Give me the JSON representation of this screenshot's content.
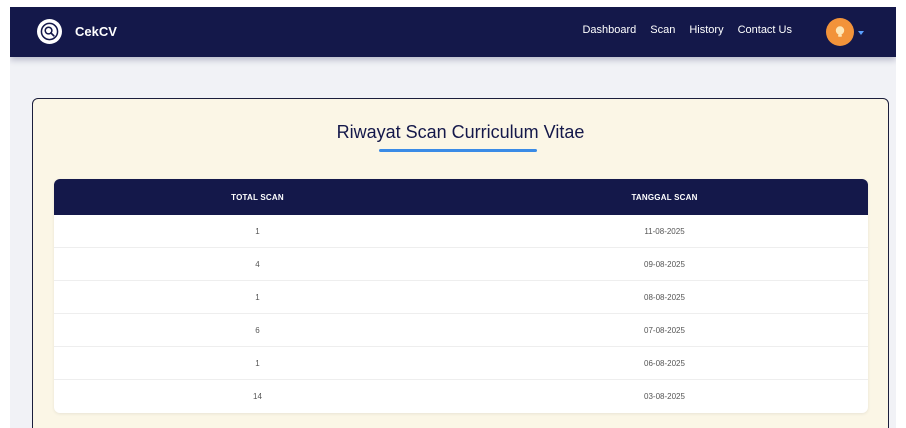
{
  "brand": {
    "name": "CekCV"
  },
  "nav": {
    "links": [
      "Dashboard",
      "Scan",
      "History",
      "Contact Us"
    ],
    "avatar_icon": "lightbulb-icon",
    "caret_icon": "chevron-down-icon"
  },
  "main": {
    "title": "Riwayat Scan Curriculum Vitae",
    "table": {
      "headers": [
        "TOTAL SCAN",
        "TANGGAL SCAN"
      ],
      "rows": [
        [
          "1",
          "11-08-2025"
        ],
        [
          "4",
          "09-08-2025"
        ],
        [
          "1",
          "08-08-2025"
        ],
        [
          "6",
          "07-08-2025"
        ],
        [
          "1",
          "06-08-2025"
        ],
        [
          "14",
          "03-08-2025"
        ]
      ]
    }
  },
  "colors": {
    "navbar": "#14184a",
    "card_background": "#fbf6e6",
    "accent": "#3a8be6",
    "avatar": "#f2933a"
  }
}
